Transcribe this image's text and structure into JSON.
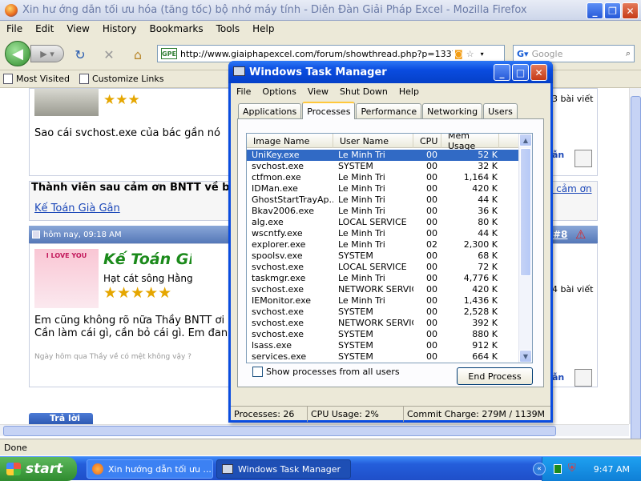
{
  "browser": {
    "title": "Xin hư ớng dẫn tối ưu hóa (tăng tốc) bộ nhớ máy tính - Diễn Đàn Giải Pháp Excel - Mozilla Firefox",
    "menu": [
      "File",
      "Edit",
      "View",
      "History",
      "Bookmarks",
      "Tools",
      "Help"
    ],
    "url": "http://www.giaiphapexcel.com/forum/showthread.php?p=133754#po:",
    "url_favicon": "GPE",
    "search_placeholder": "Google",
    "bookmarks": [
      "Most Visited",
      "Customize Links"
    ],
    "status": "Done"
  },
  "forum": {
    "post1_text": "Sao cái svchost.exe của bác gần nó",
    "post1_count": "3 bài viết",
    "thanks_header": "Thành viên sau cảm ơn BNTT về bà",
    "thanks_link": "á cảm ơn",
    "thanks_user": "Kế Toán Già Gân",
    "post2_date": "hôm nay, 09:18 AM",
    "post2_num": "#8",
    "post2_user": "Kế Toán Già Gâ",
    "post2_title": "Hạt cát sông Hằng",
    "post2_avatar_text": "I LOVE YOU",
    "post2_count": "4 bài viết",
    "post2_line1": "Em cũng không rõ nữa Thầy BNTT ơi",
    "post2_line2": "Cần làm cái gì, cần bỏ cái gì. Em đan",
    "post2_sig": "Ngày hôm qua Thầy về có mệt không vậy ?",
    "reply_button": "Trả lời",
    "quote_label": "ẫn"
  },
  "taskmgr": {
    "title": "Windows Task Manager",
    "menu": [
      "File",
      "Options",
      "View",
      "Shut Down",
      "Help"
    ],
    "tabs": [
      "Applications",
      "Processes",
      "Performance",
      "Networking",
      "Users"
    ],
    "columns": [
      "Image Name",
      "User Name",
      "CPU",
      "Mem Usage"
    ],
    "processes": [
      {
        "name": "UniKey.exe",
        "user": "Le Minh Tri",
        "cpu": "00",
        "mem": "52 K",
        "selected": true
      },
      {
        "name": "svchost.exe",
        "user": "SYSTEM",
        "cpu": "00",
        "mem": "32 K"
      },
      {
        "name": "ctfmon.exe",
        "user": "Le Minh Tri",
        "cpu": "00",
        "mem": "1,164 K"
      },
      {
        "name": "IDMan.exe",
        "user": "Le Minh Tri",
        "cpu": "00",
        "mem": "420 K"
      },
      {
        "name": "GhostStartTrayAp...",
        "user": "Le Minh Tri",
        "cpu": "00",
        "mem": "44 K"
      },
      {
        "name": "Bkav2006.exe",
        "user": "Le Minh Tri",
        "cpu": "00",
        "mem": "36 K"
      },
      {
        "name": "alg.exe",
        "user": "LOCAL SERVICE",
        "cpu": "00",
        "mem": "80 K"
      },
      {
        "name": "wscntfy.exe",
        "user": "Le Minh Tri",
        "cpu": "00",
        "mem": "44 K"
      },
      {
        "name": "explorer.exe",
        "user": "Le Minh Tri",
        "cpu": "02",
        "mem": "2,300 K"
      },
      {
        "name": "spoolsv.exe",
        "user": "SYSTEM",
        "cpu": "00",
        "mem": "68 K"
      },
      {
        "name": "svchost.exe",
        "user": "LOCAL SERVICE",
        "cpu": "00",
        "mem": "72 K"
      },
      {
        "name": "taskmgr.exe",
        "user": "Le Minh Tri",
        "cpu": "00",
        "mem": "4,776 K"
      },
      {
        "name": "svchost.exe",
        "user": "NETWORK SERVICE",
        "cpu": "00",
        "mem": "420 K"
      },
      {
        "name": "IEMonitor.exe",
        "user": "Le Minh Tri",
        "cpu": "00",
        "mem": "1,436 K"
      },
      {
        "name": "svchost.exe",
        "user": "SYSTEM",
        "cpu": "00",
        "mem": "2,528 K"
      },
      {
        "name": "svchost.exe",
        "user": "NETWORK SERVICE",
        "cpu": "00",
        "mem": "392 K"
      },
      {
        "name": "svchost.exe",
        "user": "SYSTEM",
        "cpu": "00",
        "mem": "880 K"
      },
      {
        "name": "lsass.exe",
        "user": "SYSTEM",
        "cpu": "00",
        "mem": "912 K"
      },
      {
        "name": "services.exe",
        "user": "SYSTEM",
        "cpu": "00",
        "mem": "664 K"
      }
    ],
    "show_all_label": "Show processes from all users",
    "end_process_label": "End Process",
    "status": {
      "processes": "Processes: 26",
      "cpu": "CPU Usage: 2%",
      "commit": "Commit Charge: 279M / 1139M"
    }
  },
  "taskbar": {
    "start_label": "start",
    "items": [
      "Xin hướng dẫn tối ưu ...",
      "Windows Task Manager"
    ],
    "clock": "9:47 AM"
  },
  "colors": {
    "selection": "#316ac5",
    "xp_blue": "#0a4ce0",
    "link": "#1b47b8",
    "forum_green": "#1b8a1b"
  }
}
